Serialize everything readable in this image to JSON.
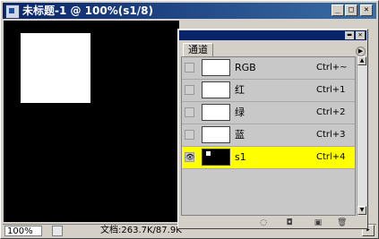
{
  "window": {
    "title": "未标题-1 @ 100%(s1/8)",
    "buttons": {
      "minimize": "_",
      "maximize": "□",
      "close": "✕"
    }
  },
  "status_bar": {
    "zoom": "100%",
    "doc_info": "文档:263.7K/87.9K"
  },
  "channels_palette": {
    "tab_label": "通道",
    "channels": [
      {
        "name": "RGB",
        "shortcut": "Ctrl+~",
        "visible": false,
        "selected": false,
        "thumb": "white"
      },
      {
        "name": "红",
        "shortcut": "Ctrl+1",
        "visible": false,
        "selected": false,
        "thumb": "white"
      },
      {
        "name": "绿",
        "shortcut": "Ctrl+2",
        "visible": false,
        "selected": false,
        "thumb": "white"
      },
      {
        "name": "蓝",
        "shortcut": "Ctrl+3",
        "visible": false,
        "selected": false,
        "thumb": "white"
      },
      {
        "name": "s1",
        "shortcut": "Ctrl+4",
        "visible": true,
        "selected": true,
        "thumb": "black"
      }
    ],
    "footer_icons": [
      "load-selection-icon",
      "save-selection-icon",
      "new-channel-icon",
      "trash-icon"
    ]
  },
  "colors": {
    "titlebar": "#0a246a",
    "selected_row": "#ffff00",
    "canvas": "#000000"
  }
}
